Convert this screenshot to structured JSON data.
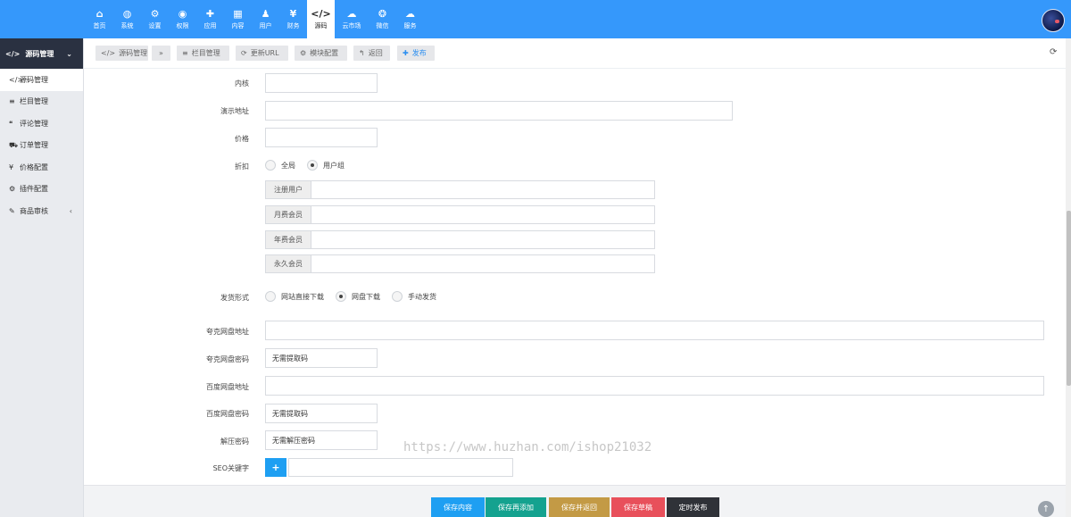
{
  "topnav": [
    {
      "icon": "⌂",
      "label": "首页"
    },
    {
      "icon": "◍",
      "label": "系统"
    },
    {
      "icon": "⚙",
      "label": "设置"
    },
    {
      "icon": "◉",
      "label": "权限"
    },
    {
      "icon": "✚",
      "label": "应用"
    },
    {
      "icon": "▦",
      "label": "内容"
    },
    {
      "icon": "♟",
      "label": "用户"
    },
    {
      "icon": "¥",
      "label": "财务"
    },
    {
      "icon": "</>",
      "label": "源码"
    },
    {
      "icon": "☁",
      "label": "云市场"
    },
    {
      "icon": "❂",
      "label": "微信"
    },
    {
      "icon": "☁",
      "label": "服务"
    }
  ],
  "sidebar": {
    "header": {
      "icon": "</>",
      "label": "源码管理",
      "chevron": "⌄"
    },
    "items": [
      {
        "icon": "</>",
        "label": "源码管理"
      },
      {
        "icon": "≡",
        "label": "栏目管理"
      },
      {
        "icon": "❝",
        "label": "评论管理"
      },
      {
        "icon": "⛟",
        "label": "订单管理"
      },
      {
        "icon": "¥",
        "label": "价格配置"
      },
      {
        "icon": "⚙",
        "label": "插件配置"
      },
      {
        "icon": "✎",
        "label": "商品审核",
        "arrow": "‹"
      }
    ]
  },
  "toolbar": {
    "source_manage": {
      "icon": "</>",
      "label": "源码管理"
    },
    "dropdown": {
      "icon": "»"
    },
    "column_manage": {
      "icon": "≡",
      "label": "栏目管理"
    },
    "update_url": {
      "icon": "⟳",
      "label": "更新URL"
    },
    "module_config": {
      "icon": "⚙",
      "label": "模块配置"
    },
    "back": {
      "icon": "↰",
      "label": "返回"
    },
    "publish": {
      "icon": "✚",
      "label": "发布"
    },
    "refresh_icon": "⟳"
  },
  "form": {
    "kernel": {
      "label": "内核",
      "value": ""
    },
    "demo_url": {
      "label": "演示地址",
      "value": ""
    },
    "price": {
      "label": "价格",
      "value": ""
    },
    "discount": {
      "label": "折扣",
      "options": [
        "全局",
        "用户组"
      ],
      "selected": "用户组",
      "groups": [
        "注册用户",
        "月费会员",
        "年费会员",
        "永久会员"
      ]
    },
    "delivery": {
      "label": "发货形式",
      "options": [
        "网站直接下载",
        "网盘下载",
        "手动发货"
      ],
      "selected": "网盘下载"
    },
    "quark_url": {
      "label": "夸克网盘地址",
      "value": ""
    },
    "quark_code": {
      "label": "夸克网盘密码",
      "value": "无需提取码"
    },
    "baidu_url": {
      "label": "百度网盘地址",
      "value": ""
    },
    "baidu_code": {
      "label": "百度网盘密码",
      "value": "无需提取码"
    },
    "unzip_password": {
      "label": "解压密码",
      "value": "无需解压密码"
    },
    "seo_keywords": {
      "label": "SEO关键字",
      "add_icon": "+",
      "value": ""
    }
  },
  "watermark": "https://www.huzhan.com/ishop21032",
  "bottom_buttons": [
    {
      "label": "保存内容",
      "color": "#1e9ff2"
    },
    {
      "label": "保存再添加",
      "color": "#14a28f"
    },
    {
      "label": "保存并返回",
      "color": "#c39a45"
    },
    {
      "label": "保存草稿",
      "color": "#e8505b"
    },
    {
      "label": "定时发布",
      "color": "#2f3238"
    }
  ],
  "scroll_top_icon": "↑"
}
